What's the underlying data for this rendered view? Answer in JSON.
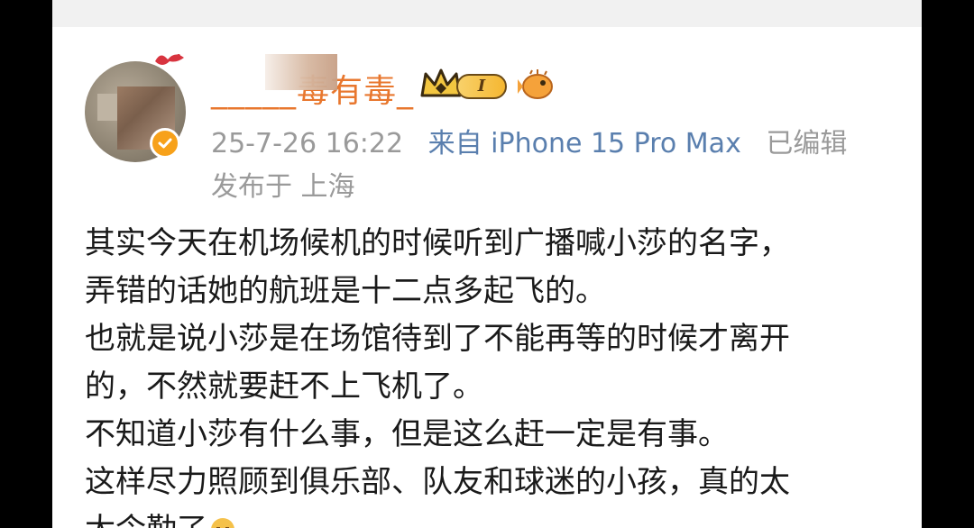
{
  "post": {
    "username": "_____毒有毒_",
    "level_badge": "I",
    "timestamp": "25-7-26 16:22",
    "source": "来自 iPhone 15 Pro Max",
    "edited": "已编辑",
    "location": "发布于 上海",
    "lines": [
      "其实今天在机场候机的时候听到广播喊小莎的名字，",
      "弄错的话她的航班是十二点多起飞的。",
      "也就是说小莎是在场馆待到了不能再等的时候才离开",
      "的，不然就要赶不上飞机了。",
      "不知道小莎有什么事，但是这么赶一定是有事。",
      "这样尽力照顾到俱乐部、队友和球迷的小孩，真的太",
      "太令勤了"
    ]
  },
  "colors": {
    "username": "#e8772e",
    "meta": "#9a9a9a",
    "verified": "#f7a11a",
    "body_text": "#1a1a1a"
  },
  "icons": {
    "verified": "verified-check-icon",
    "crown": "crown-icon",
    "fish": "pufferfish-icon",
    "emoji": "crying-face-icon"
  }
}
